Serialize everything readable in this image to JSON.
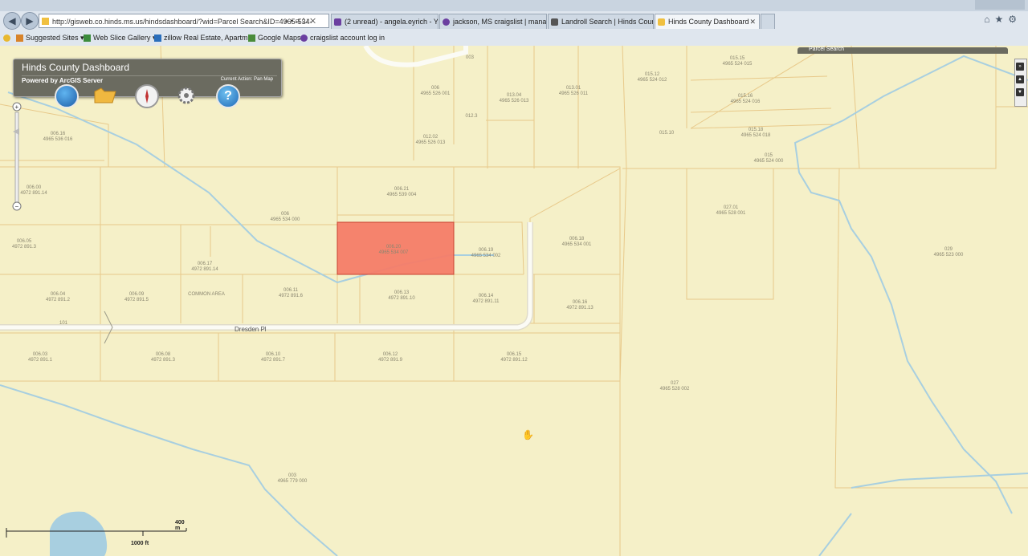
{
  "browser": {
    "url": "http://gisweb.co.hinds.ms.us/hindsdashboard/?wid=Parcel Search&ID=4965-534-",
    "url_host_bold": "hinds.ms.us",
    "tabs": [
      {
        "label": "(2 unread) - angela.eyrich - Ya...",
        "active": false,
        "icon_color": "#6b3fa0"
      },
      {
        "label": "jackson, MS craigslist | manag...",
        "active": false,
        "icon_color": "#6b3fa0"
      },
      {
        "label": "Landroll Search | Hinds County...",
        "active": false,
        "icon_color": "#555555"
      },
      {
        "label": "Hinds County Dashboard",
        "active": true,
        "icon_color": "#f0c040"
      }
    ],
    "favorites": [
      {
        "label": "Suggested Sites ▾",
        "icon_color": "#d8832a"
      },
      {
        "label": "Web Slice Gallery ▾",
        "icon_color": "#3c8c3c"
      },
      {
        "label": "zillow Real Estate, Apartm...",
        "icon_color": "#2a6ebb"
      },
      {
        "label": "Google Maps",
        "icon_color": "#4a8c3a"
      },
      {
        "label": "craigslist account log in",
        "icon_color": "#6b3fa0"
      }
    ]
  },
  "dashboard": {
    "title": "Hinds County Dashboard",
    "subtitle": "Powered by ArcGIS Server",
    "current_action": "Current Action: Pan Map",
    "tools": [
      "globe-icon",
      "folder-icon",
      "compass-icon",
      "gear-icon",
      "help-icon"
    ],
    "parcel_search_strip": "Parcel Search"
  },
  "map": {
    "road_label": "Dresden Pl",
    "road_number": "101",
    "highlight_color": "#f47c68",
    "parcels": [
      {
        "id": "p1",
        "line1": "006.16",
        "line2": "4965 536 016"
      },
      {
        "id": "p2",
        "line1": "006.00",
        "line2": "4972 891.14"
      },
      {
        "id": "p3",
        "line1": "006.05",
        "line2": "4972 891.3"
      },
      {
        "id": "p4",
        "line1": "006",
        "line2": "4965 534 000"
      },
      {
        "id": "p5",
        "line1": "006.21",
        "line2": "4965 539 004"
      },
      {
        "id": "p6",
        "line1": "006.20",
        "line2": "4965 534 007"
      },
      {
        "id": "p7",
        "line1": "006.19",
        "line2": "4965 534 002"
      },
      {
        "id": "p8",
        "line1": "006.18",
        "line2": "4965 534 001"
      },
      {
        "id": "p9",
        "line1": "006.17",
        "line2": "4972 891.14"
      },
      {
        "id": "p10",
        "line1": "006.04",
        "line2": "4972 891.2"
      },
      {
        "id": "p11",
        "line1": "006.09",
        "line2": "4972 891.5"
      },
      {
        "id": "p12",
        "line1": "COMMON AREA",
        "line2": ""
      },
      {
        "id": "p13",
        "line1": "006.11",
        "line2": "4972 891.6"
      },
      {
        "id": "p14",
        "line1": "006.13",
        "line2": "4972 891.10"
      },
      {
        "id": "p15",
        "line1": "006.14",
        "line2": "4972 891.11"
      },
      {
        "id": "p16",
        "line1": "006.16",
        "line2": "4972 891.13"
      },
      {
        "id": "p17",
        "line1": "006.03",
        "line2": "4972 891.1"
      },
      {
        "id": "p18",
        "line1": "006.08",
        "line2": "4972 891.3"
      },
      {
        "id": "p19",
        "line1": "006.10",
        "line2": "4972 891.7"
      },
      {
        "id": "p20",
        "line1": "006.12",
        "line2": "4972 891.9"
      },
      {
        "id": "p21",
        "line1": "006.15",
        "line2": "4972 891.12"
      },
      {
        "id": "p22",
        "line1": "006",
        "line2": "4965 526 001"
      },
      {
        "id": "p23",
        "line1": "012.3",
        "line2": ""
      },
      {
        "id": "p24",
        "line1": "013.04",
        "line2": "4965 526 013"
      },
      {
        "id": "p25",
        "line1": "013.01",
        "line2": "4965 526 011"
      },
      {
        "id": "p26",
        "line1": "012.02",
        "line2": "4965 526 013"
      },
      {
        "id": "p27",
        "line1": "015.12",
        "line2": "4965 524 012"
      },
      {
        "id": "p28",
        "line1": "015.15",
        "line2": "4965 524 015"
      },
      {
        "id": "p29",
        "line1": "015.16",
        "line2": "4965 524 016"
      },
      {
        "id": "p30",
        "line1": "015.18",
        "line2": "4965 524 018"
      },
      {
        "id": "p31",
        "line1": "015",
        "line2": "4965 524 000"
      },
      {
        "id": "p32",
        "line1": "015.10",
        "line2": ""
      },
      {
        "id": "p33",
        "line1": "027.01",
        "line2": "4965 528 001"
      },
      {
        "id": "p34",
        "line1": "029",
        "line2": "4965 523 000"
      },
      {
        "id": "p35",
        "line1": "027",
        "line2": "4965 528 002"
      },
      {
        "id": "p36",
        "line1": "003",
        "line2": "4965 779 000"
      },
      {
        "id": "p37",
        "line1": "003",
        "line2": ""
      }
    ],
    "scale_top": "400 m",
    "scale_bottom": "1000 ft"
  }
}
